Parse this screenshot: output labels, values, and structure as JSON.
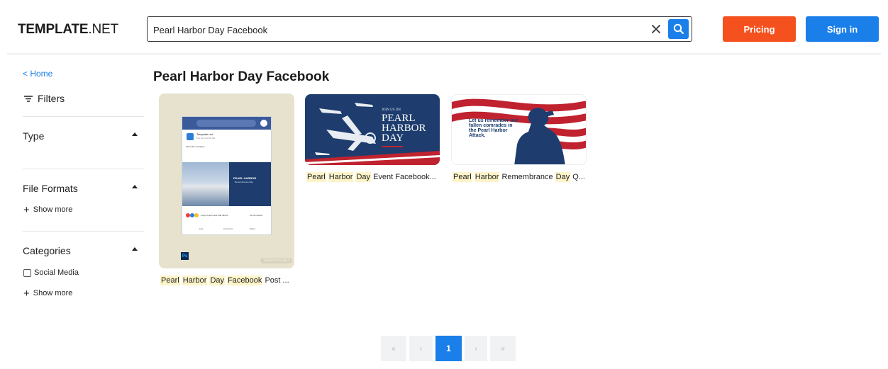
{
  "brand": {
    "logo_bold": "TEMPLATE",
    "logo_thin": ".NET"
  },
  "search": {
    "value": "Pearl Harbor Day Facebook"
  },
  "header": {
    "pricing_label": "Pricing",
    "signin_label": "Sign in"
  },
  "sidebar": {
    "home_label": "< Home",
    "filters_label": "Filters",
    "sections": [
      {
        "title": "Type"
      },
      {
        "title": "File Formats",
        "show_more": "Show more"
      },
      {
        "title": "Categories",
        "checkbox_label": "Social Media",
        "show_more": "Show more"
      }
    ]
  },
  "main": {
    "title": "Pearl Harbor Day Facebook",
    "cards": [
      {
        "caption_words": [
          "Pearl",
          "Harbor",
          "Day",
          "Facebook"
        ],
        "caption_rest": "Post ...",
        "post_header": "Template.net",
        "post_sub": "Feb 02 at 12:00 AM",
        "post_about": "About the Company",
        "post_title_line1": "PEARL HARBOR",
        "post_title_line2": "Remembrance Day",
        "post_reactions": "Lorem Ipsum and 100 others",
        "post_comments": "10 comments",
        "post_like": "Like",
        "post_comment": "Comment",
        "post_share": "Share",
        "badge": "Ps",
        "watermark": "TEMPLATE.NET"
      },
      {
        "caption_words": [
          "Pearl",
          "Harbor",
          "Day",
          "Event",
          "Facebook..."
        ],
        "caption_rest": "",
        "art_kicker": "JOIN US ON",
        "art_line1": "PEARL",
        "art_line2": "HARBOR",
        "art_line3": "DAY"
      },
      {
        "caption_words": [
          "Pearl",
          "Harbor"
        ],
        "caption_middle": "Remembrance",
        "caption_words2": [
          "Day"
        ],
        "caption_rest": "Q...",
        "art_text": "Let us remember our fallen comrades in the Pearl Harbor Attack."
      }
    ]
  },
  "pagination": {
    "first": "«",
    "prev": "‹",
    "current": "1",
    "next": "›",
    "last": "»"
  },
  "colors": {
    "accent": "#1a7fe8",
    "pricing": "#f4511e",
    "navy": "#1e3d6e",
    "flag_red": "#c0232f"
  }
}
